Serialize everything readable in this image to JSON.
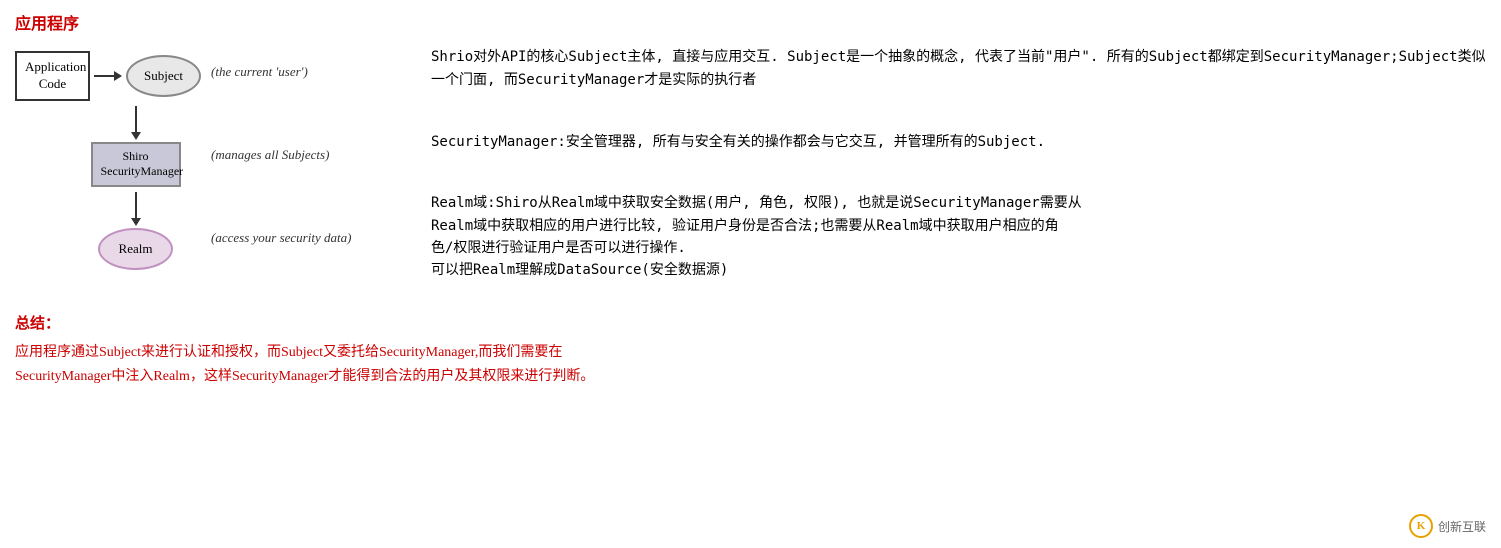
{
  "page": {
    "title": "应用程序",
    "summary_title": "总结：",
    "summary_text": "应用程序通过Subject来进行认证和授权，而Subject又委托给SecurityManager,而我们需要在\nSecurityManager中注入Realm，这样SecurityManager才能得到合法的用户及其权限来进行判断。"
  },
  "diagram": {
    "app_code_label": "Application\nCode",
    "subject_label": "Subject",
    "security_manager_label": "Shiro\nSecurityManager",
    "realm_label": "Realm",
    "subject_annotation": "(the current 'user')",
    "security_annotation": "(manages all Subjects)",
    "realm_annotation": "(access your security data)"
  },
  "descriptions": {
    "subject": "Shrio对外API的核心Subject主体, 直接与应用交互. Subject是一个抽象的概念, 代表了当前\"用户\". 所有的Subject都绑定到SecurityManager;Subject类似一个门面, 而SecurityManager才是实际的执行者",
    "security": "SecurityManager:安全管理器, 所有与安全有关的操作都会与它交互, 并管理所有的Subject.",
    "realm_line1": "Realm域:Shiro从Realm域中获取安全数据(用户, 角色, 权限), 也就是说SecurityManager需要从",
    "realm_line2": "Realm域中获取相应的用户进行比较, 验证用户身份是否合法;也需要从Realm域中获取用户相应的角",
    "realm_line3": "色/权限进行验证用户是否可以进行操作.",
    "realm_line4": "可以把Realm理解成DataSource(安全数据源)"
  },
  "watermark": {
    "icon": "K",
    "text": "创新互联"
  }
}
